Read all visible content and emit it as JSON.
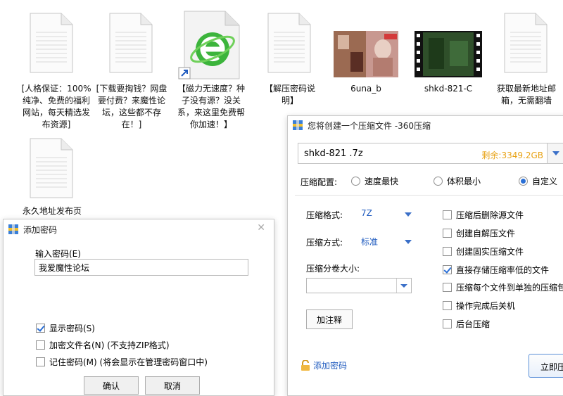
{
  "desktop": {
    "files": [
      {
        "label": "[人格保证：100%纯净、免费的福利网站，每天精选发布资源]"
      },
      {
        "label": "[下载要掏钱？网盘要付费？来魔性论坛，这些都不存在！]"
      },
      {
        "label": "【磁力无速度？种子没有源？没关系，来这里免费帮你加速！】"
      },
      {
        "label": "【解压密码说明】"
      },
      {
        "label": "6una_b"
      },
      {
        "label": "shkd-821-C"
      },
      {
        "label": "获取最新地址邮箱，无需翻墙"
      },
      {
        "label": "永久地址发布页"
      }
    ]
  },
  "password_dialog": {
    "title": "添加密码",
    "input_label": "输入密码(E)",
    "password_value": "我爱魔性论坛",
    "options": [
      {
        "label": "显示密码(S)",
        "checked": true
      },
      {
        "label": "加密文件名(N) (不支持ZIP格式)",
        "checked": false
      },
      {
        "label": "记住密码(M) (将会显示在管理密码窗口中)",
        "checked": false
      }
    ],
    "ok_label": "确认",
    "cancel_label": "取消"
  },
  "compress_dialog": {
    "title": "您将创建一个压缩文件 -360压缩",
    "filename": "shkd-821 .7z",
    "free_space": "剩余:3349.2GB",
    "config_label": "压缩配置:",
    "config_options": [
      {
        "label": "速度最快",
        "checked": false
      },
      {
        "label": "体积最小",
        "checked": false
      },
      {
        "label": "自定义",
        "checked": true
      }
    ],
    "format_label": "压缩格式:",
    "format_value": "7Z",
    "method_label": "压缩方式:",
    "method_value": "标准",
    "split_label": "压缩分卷大小:",
    "comment_button": "加注释",
    "add_password": "添加密码",
    "start_button": "立即压",
    "checkboxes": [
      {
        "label": "压缩后删除源文件",
        "checked": false
      },
      {
        "label": "创建自解压文件",
        "checked": false
      },
      {
        "label": "创建固实压缩文件",
        "checked": false
      },
      {
        "label": "直接存储压缩率低的文件",
        "checked": true
      },
      {
        "label": "压缩每个文件到单独的压缩包",
        "checked": false
      },
      {
        "label": "操作完成后关机",
        "checked": false
      },
      {
        "label": "后台压缩",
        "checked": false
      }
    ],
    "accent_color": "#2a6fd6",
    "free_space_color": "#e8a317"
  }
}
